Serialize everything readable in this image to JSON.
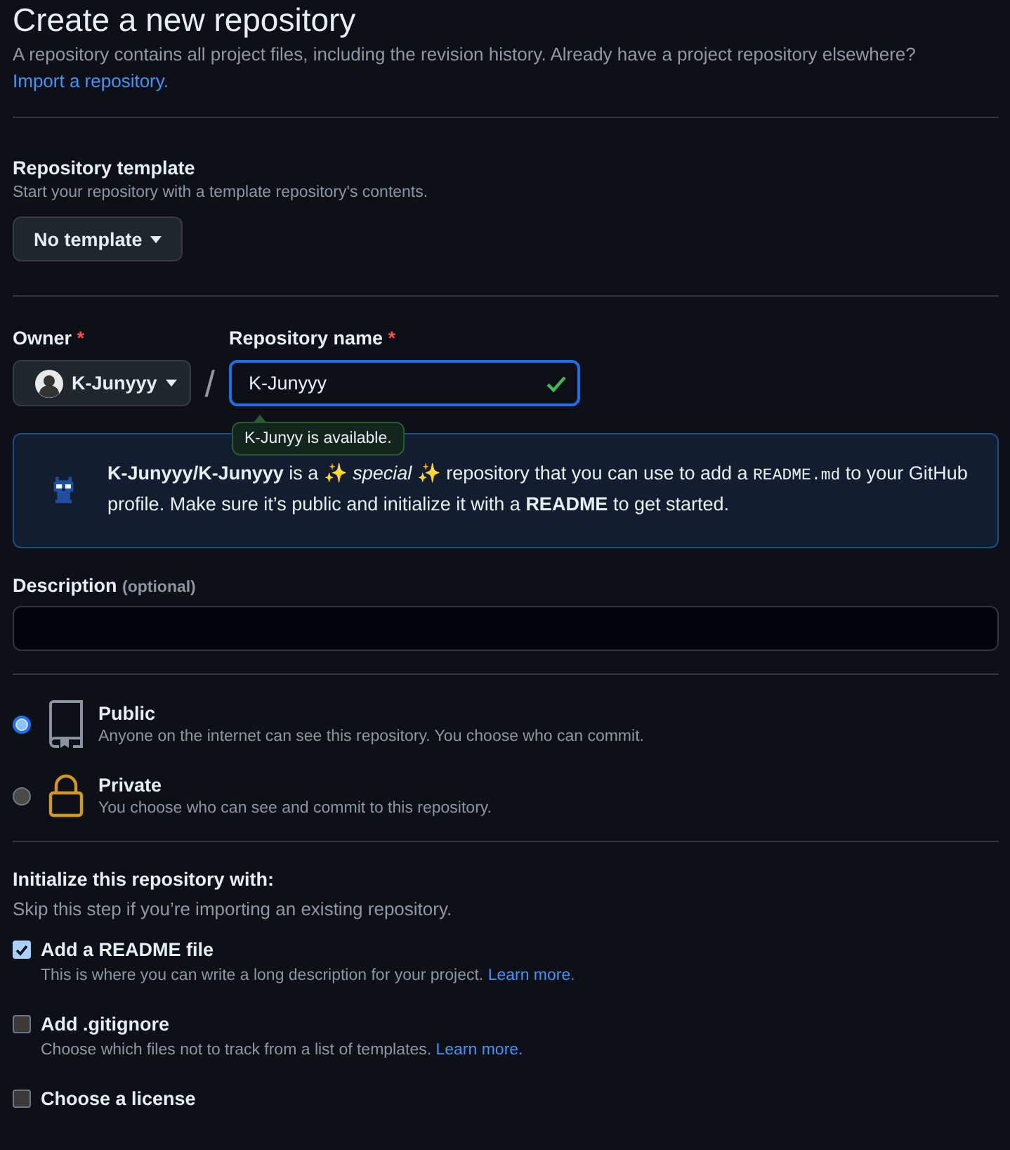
{
  "heading": {
    "title": "Create a new repository",
    "subtitle": "A repository contains all project files, including the revision history. Already have a project repository elsewhere?",
    "import_link": "Import a repository."
  },
  "template": {
    "label": "Repository template",
    "hint": "Start your repository with a template repository's contents.",
    "button": "No template"
  },
  "owner": {
    "label": "Owner",
    "required_mark": "*",
    "button": "K-Junyyy"
  },
  "separator": "/",
  "repo_name": {
    "label": "Repository name",
    "required_mark": "*",
    "value": "K-Junyyy",
    "valid": true,
    "tooltip": "K-Junyy is available."
  },
  "banner": {
    "text_before": "**K-Junyyy/K-Junyyy** is a ✨ *special* ✨ repository that you can use to add a ",
    "code": "README.md",
    "text_after": " to your GitHub profile. Make sure it’s public and initialize it with a **README** to get started."
  },
  "description": {
    "label": "Description",
    "hint": "(optional)"
  },
  "visibility": [
    {
      "kind": "public",
      "title": "Public",
      "description": "Anyone on the internet can see this repository. You choose who can commit.",
      "selected": true
    },
    {
      "kind": "private",
      "title": "Private",
      "description": "You choose who can see and commit to this repository.",
      "selected": false
    }
  ],
  "initialize": {
    "title": "Initialize this repository with:",
    "hint": "Skip this step if you’re importing an existing repository.",
    "options": [
      {
        "label": "Add a README file",
        "description": "This is where you can write a long description for your project.",
        "link": "Learn more.",
        "checked": true
      },
      {
        "label": "Add .gitignore",
        "description": "Choose which files not to track from a list of templates.",
        "link": "Learn more.",
        "checked": false
      },
      {
        "label": "Choose a license",
        "checked": false
      }
    ]
  }
}
